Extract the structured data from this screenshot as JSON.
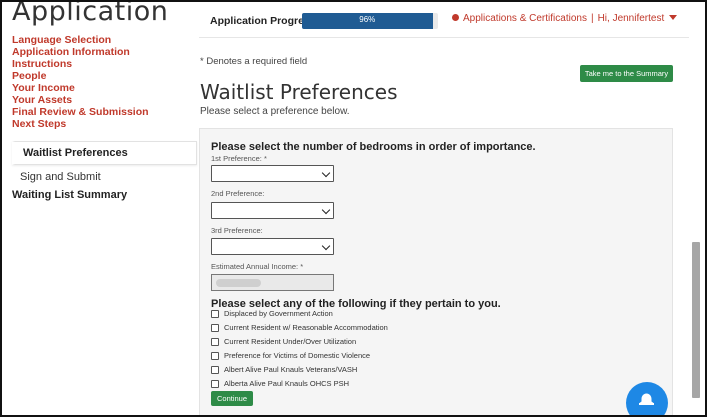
{
  "sidebar": {
    "title": "Application",
    "links": [
      "Language Selection",
      "Application Information",
      "Instructions",
      "People",
      "Your Income",
      "Your Assets",
      "Final Review & Submission",
      "Next Steps"
    ],
    "active_sub": "Waitlist Preferences",
    "sub_item": "Sign and Submit",
    "bottom_item": "Waiting List Summary"
  },
  "header": {
    "progress_label": "Application Progress",
    "progress_value": 96,
    "progress_text": "96%",
    "apps_link": "Applications & Certifications",
    "user_link": "Hi, Jennifertest"
  },
  "main": {
    "required_note": "* Denotes a required field",
    "summary_button": "Take me to the Summary",
    "title": "Waitlist Preferences",
    "subtitle": "Please select a preference below.",
    "bedrooms_question": "Please select the number of bedrooms in order of importance.",
    "pref1_label": "1st Preference: *",
    "pref2_label": "2nd Preference:",
    "pref3_label": "3rd Preference:",
    "income_label": "Estimated Annual Income: *",
    "pertain_question": "Please select any of the following if they pertain to you.",
    "checkboxes": [
      "Displaced by Government Action",
      "Current Resident w/ Reasonable Accommodation",
      "Current Resident Under/Over Utilization",
      "Preference for Victims of Domestic Violence",
      "Albert Alive Paul Knauls Veterans/VASH",
      "Alberta Alive Paul Knauls OHCS PSH"
    ],
    "continue_button": "Continue"
  },
  "colors": {
    "accent_red": "#c0392b",
    "progress_blue": "#1f5b93",
    "button_green": "#2e8b47",
    "fab_blue": "#1e88e5"
  },
  "icons": {
    "header_dot": "red-dot-icon",
    "user_caret": "caret-down-icon",
    "select_caret": "chevron-down-icon",
    "fab": "bell-icon"
  }
}
